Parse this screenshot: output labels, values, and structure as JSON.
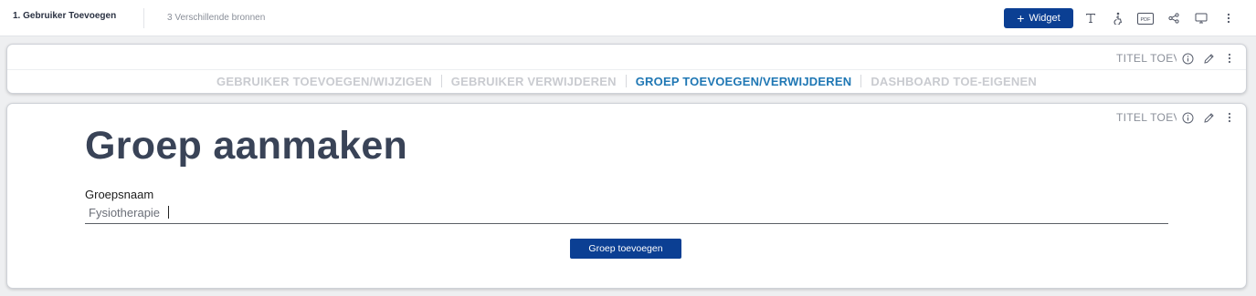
{
  "topbar": {
    "title": "1. Gebruiker Toevoegen",
    "sources": "3 Verschillende bronnen",
    "widget_button": "Widget",
    "icons": [
      "text-icon",
      "accessibility-icon",
      "pdf-icon",
      "share-icon",
      "monitor-icon",
      "more-vertical-icon"
    ],
    "pdf_label": "PDF"
  },
  "tabs_card": {
    "title_placeholder": "TITEL TOEVOEGEN",
    "tabs": [
      {
        "label": "GEBRUIKER TOEVOEGEN/WIJZIGEN",
        "active": false
      },
      {
        "label": "GEBRUIKER VERWIJDEREN",
        "active": false
      },
      {
        "label": "GROEP TOEVOEGEN/VERWIJDEREN",
        "active": true
      },
      {
        "label": "DASHBOARD TOE-EIGENEN",
        "active": false
      }
    ]
  },
  "form_card": {
    "title_placeholder": "TITEL TOEVOEGEN",
    "heading": "Groep aanmaken",
    "field_label": "Groepsnaam",
    "field_value": "Fysiotherapie",
    "submit_label": "Groep toevoegen"
  },
  "colors": {
    "primary": "#0b3f93",
    "active_tab": "#1f77b4",
    "inactive_tab": "#c9cbd0",
    "heading": "#394357"
  }
}
